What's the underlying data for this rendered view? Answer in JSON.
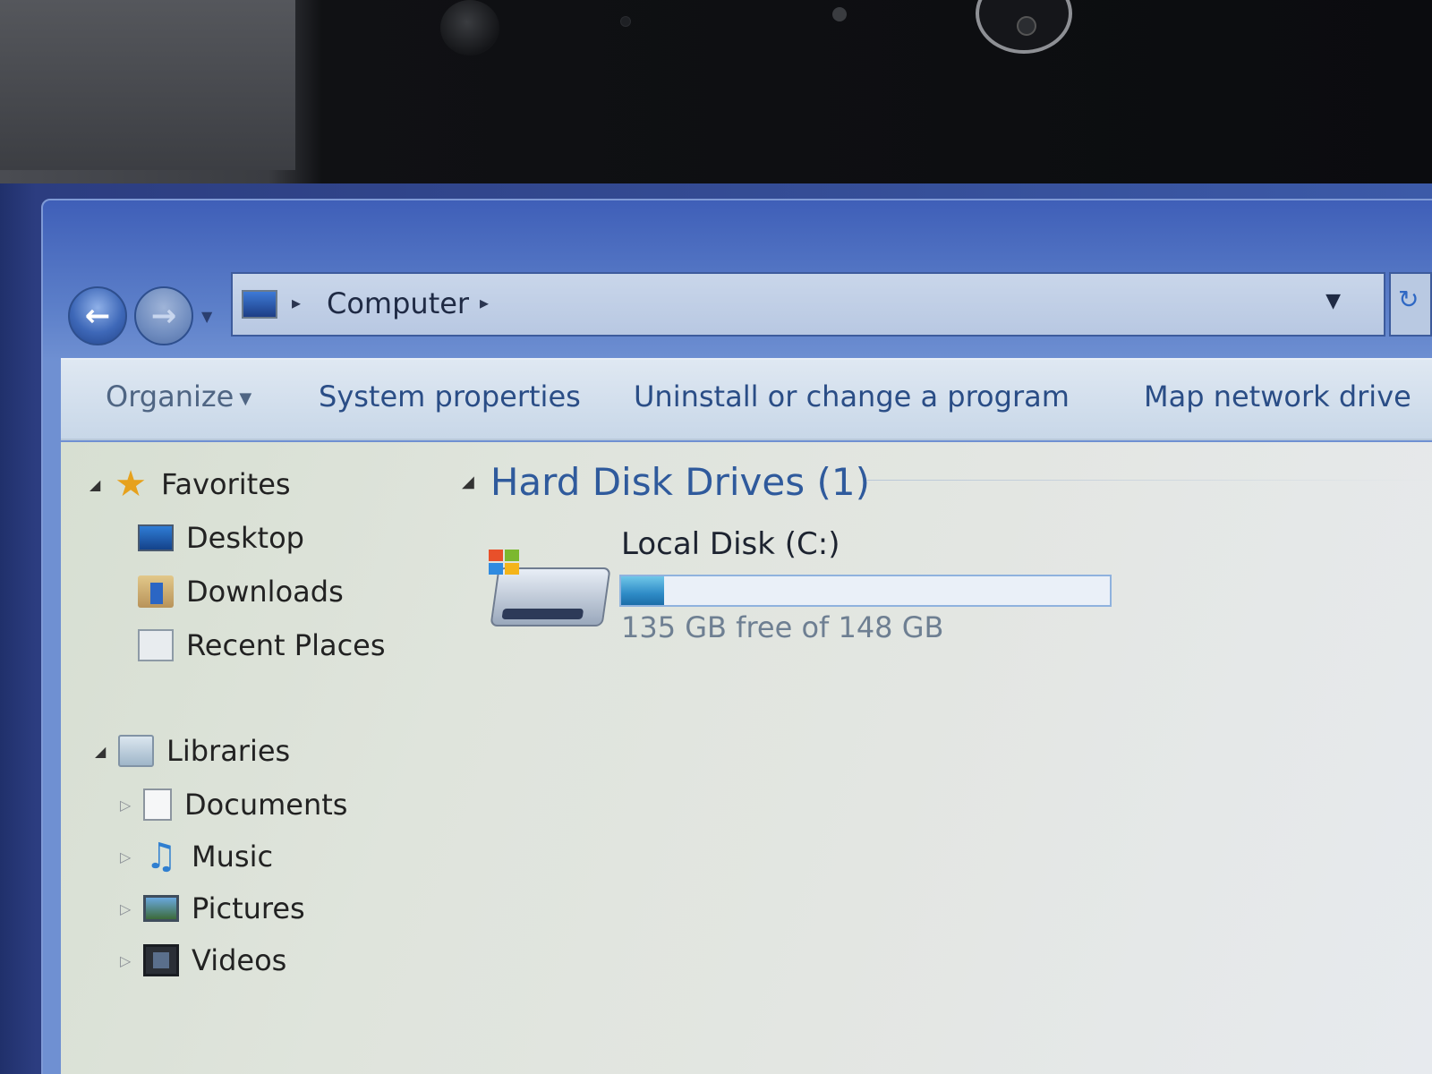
{
  "address_bar": {
    "crumbs": [
      "Computer"
    ]
  },
  "command_bar": {
    "organize_label": "Organize",
    "items": [
      "System properties",
      "Uninstall or change a program",
      "Map network drive"
    ]
  },
  "nav_pane": {
    "favorites": {
      "label": "Favorites",
      "items": [
        "Desktop",
        "Downloads",
        "Recent Places"
      ]
    },
    "libraries": {
      "label": "Libraries",
      "items": [
        "Documents",
        "Music",
        "Pictures",
        "Videos"
      ]
    }
  },
  "main": {
    "group_title": "Hard Disk Drives (1)",
    "drives": [
      {
        "name": "Local Disk (C:)",
        "free_text": "135 GB free of 148 GB",
        "used_fraction": 0.088
      }
    ]
  },
  "colors": {
    "link_blue": "#2a4d86",
    "group_title": "#2f5a9c",
    "usage_bar": "#2f8cc7"
  },
  "icons": {
    "back": "back-arrow-icon",
    "forward": "forward-arrow-icon",
    "favorites": "star-icon",
    "desktop": "desktop-icon",
    "downloads": "downloads-folder-icon",
    "recent": "recent-places-icon",
    "libraries": "libraries-icon",
    "documents": "documents-icon",
    "music": "music-note-icon",
    "pictures": "pictures-icon",
    "videos": "videos-icon",
    "drive": "hard-drive-icon"
  }
}
